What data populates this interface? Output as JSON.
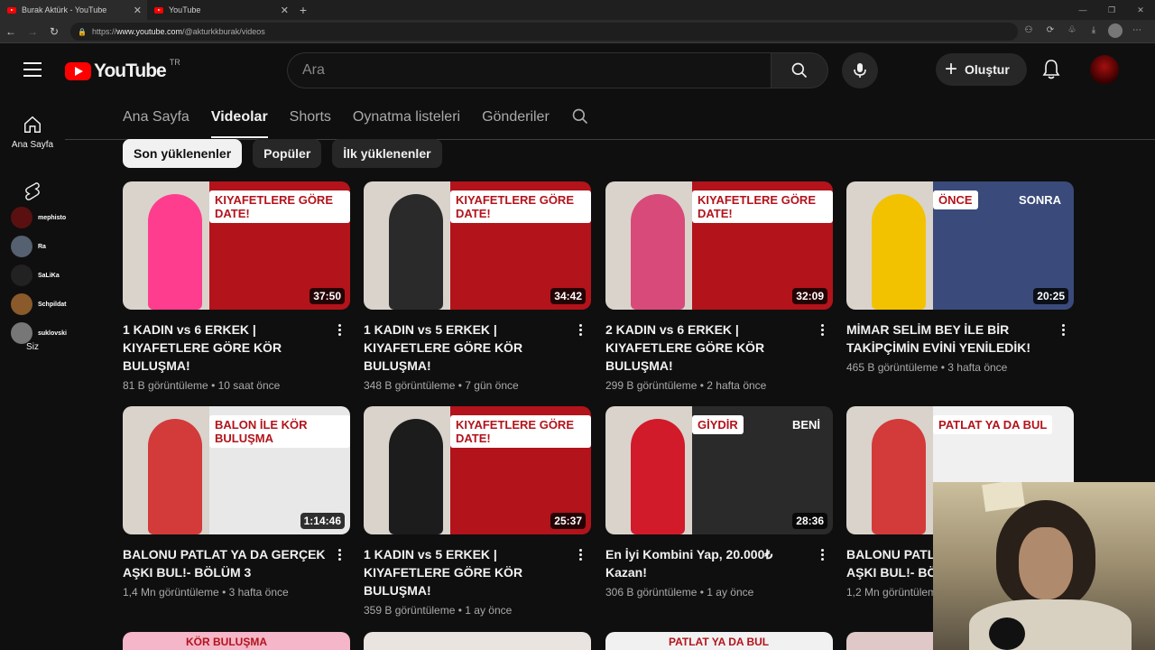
{
  "browser": {
    "tabs": [
      {
        "title": "Burak Aktürk - YouTube"
      },
      {
        "title": "YouTube"
      }
    ],
    "url_scheme": "https://",
    "url_host": "www.youtube.com",
    "url_path": "/@akturkkburak/videos"
  },
  "header": {
    "logo_text": "YouTube",
    "country_code": "TR",
    "search_placeholder": "Ara",
    "create_label": "Oluştur"
  },
  "sidebar": {
    "home_label": "Ana Sayfa",
    "you_label": "Siz",
    "chat": [
      {
        "user": "mephisto",
        "color": "#5a1010"
      },
      {
        "user": "Ra",
        "color": "#556070"
      },
      {
        "user": "SaLiKa",
        "color": "#222222"
      },
      {
        "user": "Schpildat",
        "color": "#8a5a2a"
      },
      {
        "user": "suklovski",
        "color": "#777777"
      }
    ]
  },
  "channel_tabs": [
    "Ana Sayfa",
    "Videolar",
    "Shorts",
    "Oynatma listeleri",
    "Gönderiler"
  ],
  "active_tab": "Videolar",
  "chips": [
    "Son yüklenenler",
    "Popüler",
    "İlk yüklenenler"
  ],
  "selected_chip": "Son yüklenenler",
  "videos": [
    {
      "title": "1 KADIN vs 6 ERKEK | KIYAFETLERE GÖRE KÖR BULUŞMA!",
      "views": "81 B görüntüleme",
      "age": "10 saat önce",
      "duration": "37:50",
      "thumb_text": "KIYAFETLERE GÖRE DATE!",
      "thumb_color": "#b3131b",
      "subject_color": "#ff3d8e"
    },
    {
      "title": "1 KADIN vs 5 ERKEK | KIYAFETLERE GÖRE KÖR BULUŞMA!",
      "views": "348 B görüntüleme",
      "age": "7 gün önce",
      "duration": "34:42",
      "thumb_text": "KIYAFETLERE GÖRE DATE!",
      "thumb_color": "#b3131b",
      "subject_color": "#2a2a2a"
    },
    {
      "title": "2 KADIN vs 6 ERKEK | KIYAFETLERE GÖRE KÖR BULUŞMA!",
      "views": "299 B görüntüleme",
      "age": "2 hafta önce",
      "duration": "32:09",
      "thumb_text": "KIYAFETLERE GÖRE DATE!",
      "thumb_color": "#b3131b",
      "subject_color": "#d84a7a"
    },
    {
      "title": "MİMAR SELİM BEY İLE BİR TAKİPÇİMİN EVİNİ YENİLEDİK!",
      "views": "465 B görüntüleme",
      "age": "3 hafta önce",
      "duration": "20:25",
      "thumb_text": "ÖNCE",
      "thumb_text_2": "SONRA",
      "thumb_color": "#3a4a7a",
      "subject_color": "#f2c200"
    },
    {
      "title": "BALONU PATLAT YA DA GERÇEK AŞKI BUL!- BÖLÜM 3",
      "views": "1,4 Mn görüntüleme",
      "age": "3 hafta önce",
      "duration": "1:14:46",
      "thumb_text": "BALON İLE KÖR BULUŞMA",
      "thumb_color": "#e8e8e8",
      "subject_color": "#d33a3a"
    },
    {
      "title": "1 KADIN vs 5 ERKEK | KIYAFETLERE GÖRE KÖR BULUŞMA!",
      "views": "359 B görüntüleme",
      "age": "1 ay önce",
      "duration": "25:37",
      "thumb_text": "KIYAFETLERE GÖRE DATE!",
      "thumb_color": "#b3131b",
      "subject_color": "#1c1c1c"
    },
    {
      "title": "En İyi Kombini Yap, 20.000₺ Kazan!",
      "views": "306 B görüntüleme",
      "age": "1 ay önce",
      "duration": "28:36",
      "thumb_text": "GİYDİR",
      "thumb_text_2": "BENİ",
      "thumb_color": "#2a2a2a",
      "subject_color": "#d11a2a"
    },
    {
      "title": "BALONU PATLAT YA DA GERÇEK AŞKI BUL!- BÖLÜM 2",
      "views": "1,2 Mn görüntüleme",
      "age": "",
      "duration": "",
      "thumb_text": "PATLAT YA DA BUL",
      "thumb_color": "#f0f0f0",
      "subject_color": "#d33a3a"
    }
  ],
  "next_row_thumb_texts": [
    "KÖR BULUŞMA",
    "",
    "PATLAT YA DA BUL",
    ""
  ]
}
